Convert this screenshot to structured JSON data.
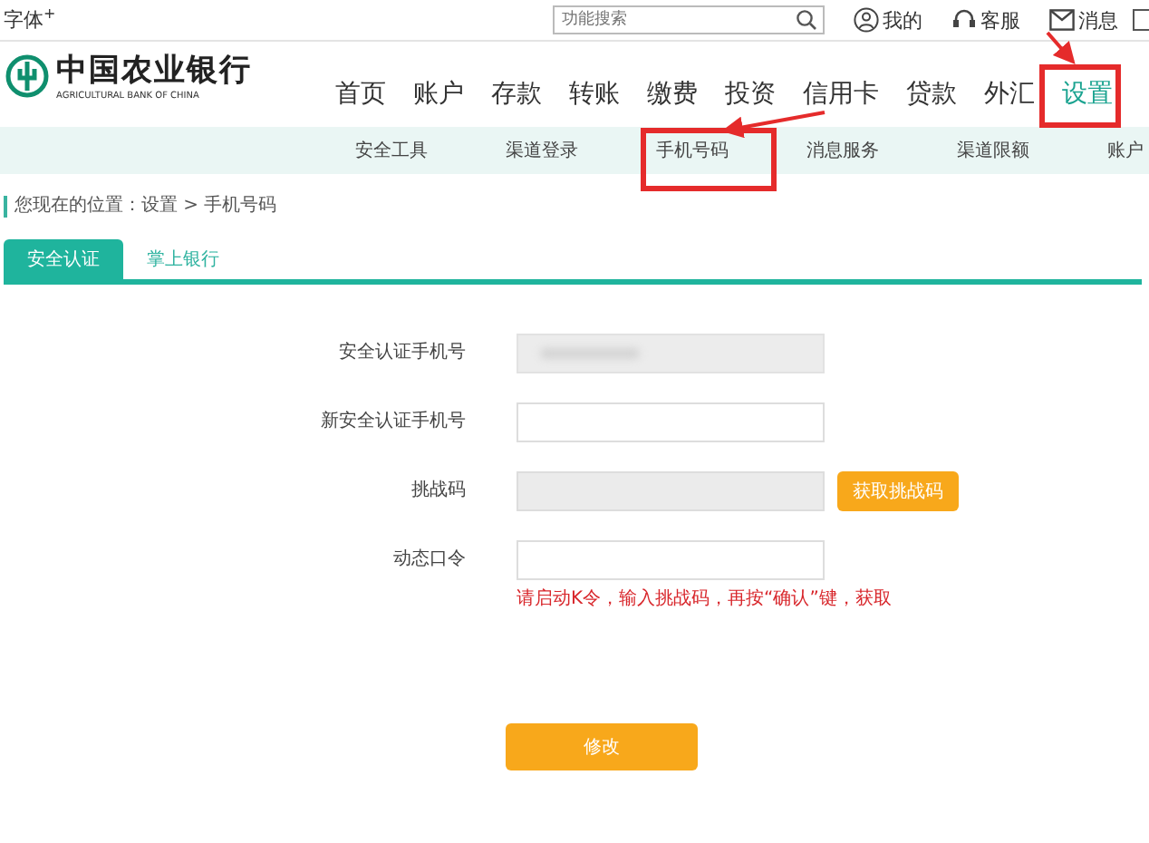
{
  "top_bar": {
    "font_size_link": "字体",
    "font_size_mark": "+",
    "search": {
      "placeholder": "功能搜索"
    },
    "links": [
      {
        "kind": "user",
        "label": "我的"
      },
      {
        "kind": "service",
        "label": "客服"
      },
      {
        "kind": "mail",
        "label": "消息"
      }
    ]
  },
  "logo": {
    "name": "中国农业银行",
    "subtitle": "AGRICULTURAL BANK OF CHINA"
  },
  "nav": [
    {
      "label": "首页",
      "selected": false
    },
    {
      "label": "账户",
      "selected": false
    },
    {
      "label": "存款",
      "selected": false
    },
    {
      "label": "转账",
      "selected": false
    },
    {
      "label": "缴费",
      "selected": false
    },
    {
      "label": "投资",
      "selected": false
    },
    {
      "label": "信用卡",
      "selected": false
    },
    {
      "label": "贷款",
      "selected": false
    },
    {
      "label": "外汇",
      "selected": false
    },
    {
      "label": "设置",
      "selected": true
    }
  ],
  "sub_nav": [
    "安全工具",
    "渠道登录",
    "手机号码",
    "消息服务",
    "渠道限额",
    "账户"
  ],
  "breadcrumb": "您现在的位置：设置 > 手机号码",
  "tabs": [
    {
      "label": "安全认证",
      "selected": true
    },
    {
      "label": "掌上银行",
      "selected": false
    }
  ],
  "form": [
    {
      "kind": "masked",
      "label": "安全认证手机号"
    },
    {
      "kind": "input",
      "label": "新安全认证手机号"
    },
    {
      "kind": "challenge",
      "label": "挑战码",
      "button": "获取挑战码"
    },
    {
      "kind": "input",
      "label": "动态口令",
      "hint": "请启动K令，输入挑战码，再按“确认”键，获取"
    }
  ],
  "submit": "修改"
}
